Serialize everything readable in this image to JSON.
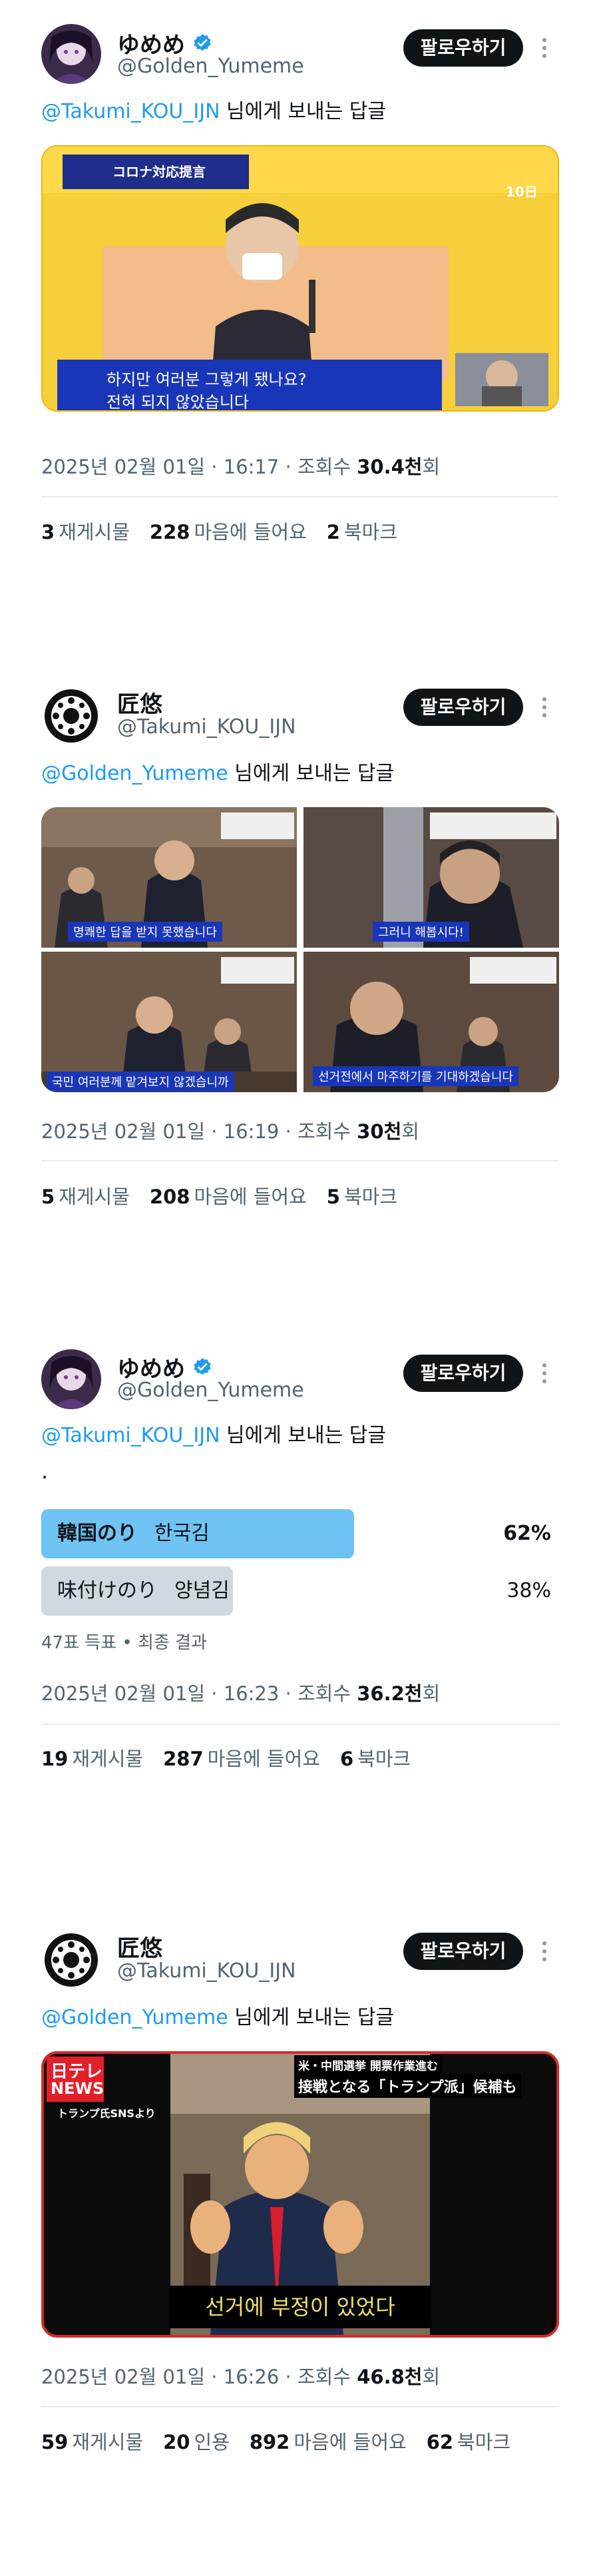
{
  "follow_label": "팔로우하기",
  "reply_suffix": " 님에게 보내는 답글",
  "labels": {
    "retweets": "재게시물",
    "likes": "마음에 들어요",
    "bookmarks": "북마크",
    "quotes": "인용"
  },
  "tweets": [
    {
      "name": "ゆめめ",
      "handle": "@Golden_Yumeme",
      "verified": true,
      "reply_to": "@Takumi_KOU_IJN",
      "media": {
        "tv_title": "コロナ対応提言",
        "tv_corner": "10日",
        "subtitle_line1": "하지만 여러분 그렇게 됐나요?",
        "subtitle_line2": "전혀 되지 않았습니다"
      },
      "meta_prefix": "2025년 02월 01일 · 16:17 · 조회수 ",
      "views": "30.4천",
      "views_suffix": "회",
      "retweets": "3",
      "likes": "228",
      "bookmarks": "2"
    },
    {
      "name": "匠悠",
      "handle": "@Takumi_KOU_IJN",
      "verified": false,
      "reply_to": "@Golden_Yumeme",
      "media": {
        "captions": [
          "명쾌한 답을 받지 못했습니다",
          "그러니 해봅시다!",
          "국민 여러분께 맡겨보지 않겠습니까",
          "선거전에서 마주하기를 기대하겠습니다"
        ]
      },
      "meta_prefix": "2025년 02월 01일 · 16:19 · 조회수 ",
      "views": "30천",
      "views_suffix": "회",
      "retweets": "5",
      "likes": "208",
      "bookmarks": "5"
    },
    {
      "name": "ゆめめ",
      "handle": "@Golden_Yumeme",
      "verified": true,
      "reply_to": "@Takumi_KOU_IJN",
      "body": ".",
      "poll": [
        {
          "label": "韓国のり",
          "label_ko": "한국김",
          "percent_text": "62%",
          "fraction": 0.62,
          "winner": true
        },
        {
          "label": "味付けのり",
          "label_ko": "양념김",
          "percent_text": "38%",
          "fraction": 0.38,
          "winner": false
        }
      ],
      "poll_footer": "47표 득표 • 최종 결과",
      "meta_prefix": "2025년 02월 01일 · 16:23 · 조회수 ",
      "views": "36.2천",
      "views_suffix": "회",
      "retweets": "19",
      "likes": "287",
      "bookmarks": "6"
    },
    {
      "name": "匠悠",
      "handle": "@Takumi_KOU_IJN",
      "verified": false,
      "reply_to": "@Golden_Yumeme",
      "media": {
        "logo_top": "日テレ",
        "logo_bottom": "NEWS",
        "source": "トランプ氏SNSより",
        "headline_top": "米・中間選挙 開票作業進む",
        "headline_main": "接戦となる「トランプ派」候補も",
        "subtitle": "선거에 부정이 있었다"
      },
      "meta_prefix": "2025년 02월 01일 · 16:26 · 조회수 ",
      "views": "46.8천",
      "views_suffix": "회",
      "retweets": "59",
      "quotes": "20",
      "likes": "892",
      "bookmarks": "62"
    }
  ]
}
